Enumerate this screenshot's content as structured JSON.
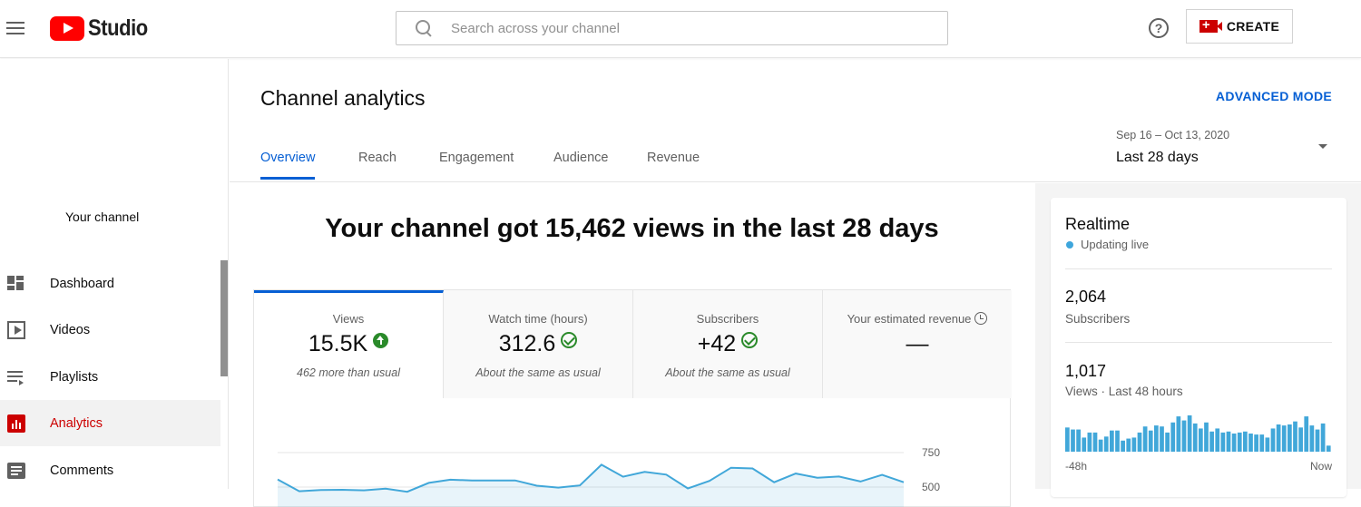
{
  "header": {
    "app_name": "Studio",
    "search_placeholder": "Search across your channel",
    "help_glyph": "?",
    "create_label": "CREATE",
    "accent_red": "#ff0000"
  },
  "sidebar": {
    "channel_label": "Your channel",
    "items": [
      {
        "label": "Dashboard",
        "icon": "dashboard-icon"
      },
      {
        "label": "Videos",
        "icon": "videos-icon"
      },
      {
        "label": "Playlists",
        "icon": "playlists-icon"
      },
      {
        "label": "Analytics",
        "icon": "analytics-icon",
        "active": true
      },
      {
        "label": "Comments",
        "icon": "comments-icon"
      }
    ]
  },
  "page": {
    "title": "Channel analytics",
    "advanced_mode": "ADVANCED MODE",
    "tabs": [
      "Overview",
      "Reach",
      "Engagement",
      "Audience",
      "Revenue"
    ],
    "active_tab": "Overview",
    "date_range": "Sep 16 – Oct 13, 2020",
    "date_select": "Last 28 days",
    "link_color": "#065fd4"
  },
  "overview": {
    "headline": "Your channel got 15,462 views in the last 28 days",
    "metrics": [
      {
        "label": "Views",
        "value": "15.5K",
        "note": "462 more than usual",
        "status_icon": "arrow-up-icon"
      },
      {
        "label": "Watch time (hours)",
        "value": "312.6",
        "note": "About the same as usual",
        "status_icon": "check-circle-icon"
      },
      {
        "label": "Subscribers",
        "value": "+42",
        "note": "About the same as usual",
        "status_icon": "check-circle-icon"
      },
      {
        "label": "Your estimated revenue",
        "value": "—",
        "note": "",
        "status_icon": "clock-icon"
      }
    ]
  },
  "chart_data": {
    "type": "area",
    "series": [
      {
        "values": [
          555,
          470,
          478,
          480,
          476,
          488,
          466,
          530,
          553,
          548,
          548,
          548,
          510,
          496,
          512,
          662,
          575,
          610,
          590,
          490,
          545,
          640,
          635,
          535,
          598,
          568,
          576,
          540,
          588,
          535
        ]
      }
    ],
    "ytick_labels": [
      "750",
      "500"
    ],
    "ylim": [
      300,
      750
    ],
    "color": "#41a7d9"
  },
  "realtime": {
    "title": "Realtime",
    "status": "Updating live",
    "subscribers_value": "2,064",
    "subscribers_label": "Subscribers",
    "views_value": "1,017",
    "views_label": "Views · Last 48 hours",
    "axis_start": "-48h",
    "axis_end": "Now",
    "bars": [
      24,
      22,
      22,
      14,
      19,
      19,
      12,
      15,
      21,
      21,
      11,
      13,
      14,
      19,
      25,
      21,
      26,
      25,
      19,
      29,
      35,
      31,
      36,
      28,
      23,
      29,
      20,
      23,
      19,
      20,
      18,
      19,
      20,
      18,
      17,
      17,
      14,
      23,
      27,
      26,
      27,
      30,
      24,
      35,
      26,
      22,
      28,
      6
    ]
  }
}
